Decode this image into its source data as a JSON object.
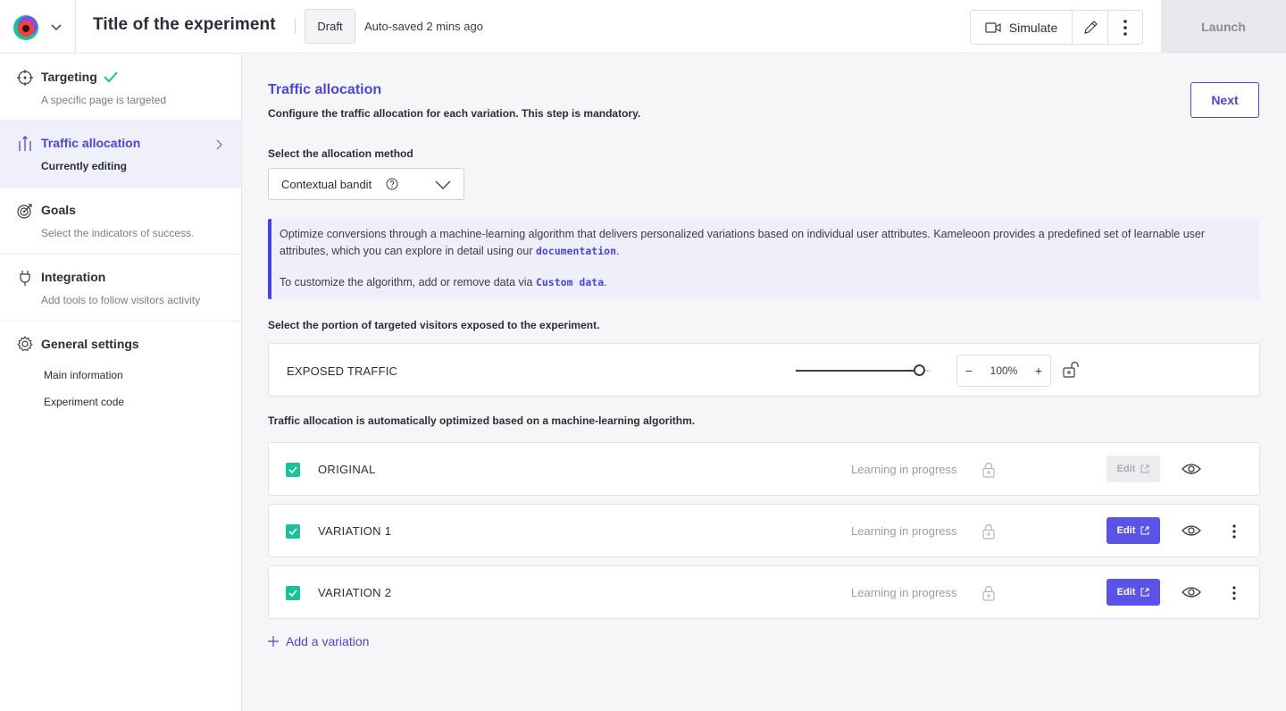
{
  "header": {
    "title": "Title of the experiment",
    "status_badge": "Draft",
    "autosave": "Auto-saved 2 mins ago",
    "simulate_label": "Simulate",
    "launch_label": "Launch"
  },
  "sidebar": {
    "steps": [
      {
        "title": "Targeting",
        "subtitle": "A specific page is targeted",
        "icon": "crosshair-icon",
        "completed": true
      },
      {
        "title": "Traffic allocation",
        "subtitle": "Currently editing",
        "icon": "traffic-bars-icon",
        "active": true
      },
      {
        "title": "Goals",
        "subtitle": "Select the indicators of success.",
        "icon": "target-icon"
      },
      {
        "title": "Integration",
        "subtitle": "Add tools to follow visitors activity",
        "icon": "plug-icon"
      },
      {
        "title": "General settings",
        "icon": "gear-icon",
        "links": [
          "Main information",
          "Experiment code"
        ]
      }
    ]
  },
  "main": {
    "title": "Traffic allocation",
    "description": "Configure the traffic allocation for each variation. This step is mandatory.",
    "next_label": "Next",
    "method_label": "Select the allocation method",
    "method_value": "Contextual bandit",
    "info": {
      "line1": "Optimize conversions through a machine-learning algorithm that delivers personalized variations based on individual user attributes. Kameleoon provides a predefined set of learnable user attributes, which you can explore in detail using our ",
      "doc_link": "documentation",
      "line1_end": ".",
      "line2": "To customize the algorithm, add or remove data via ",
      "custom_link": "Custom data",
      "line2_end": "."
    },
    "portion_label": "Select the portion of targeted visitors exposed to the experiment.",
    "exposed_traffic": {
      "label": "EXPOSED TRAFFIC",
      "value": "100%",
      "fraction": 1.0
    },
    "auto_note": "Traffic allocation is automatically optimized based on a machine-learning algorithm.",
    "variations": [
      {
        "name": "ORIGINAL",
        "status": "Learning in progress",
        "edit_label": "Edit",
        "edit_enabled": false,
        "has_menu": false,
        "checked": true
      },
      {
        "name": "VARIATION 1",
        "status": "Learning in progress",
        "edit_label": "Edit",
        "edit_enabled": true,
        "has_menu": true,
        "checked": true
      },
      {
        "name": "VARIATION 2",
        "status": "Learning in progress",
        "edit_label": "Edit",
        "edit_enabled": true,
        "has_menu": true,
        "checked": true
      }
    ],
    "add_variation_label": "Add a variation"
  },
  "colors": {
    "accent": "#4b45d9",
    "button_primary": "#5b52e8",
    "checkbox": "#19c29a",
    "check_mark": "#19c29a"
  }
}
